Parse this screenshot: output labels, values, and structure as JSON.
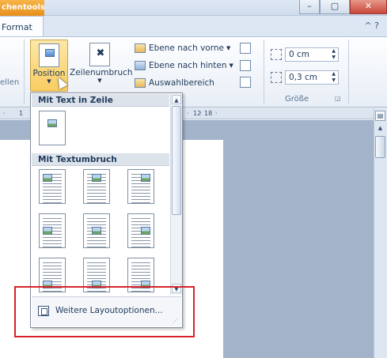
{
  "titlebar": {
    "context_tab_label": "chentools",
    "minimize": "–",
    "restore": "▢",
    "close": "✕"
  },
  "tabs": {
    "active_tab": "Format",
    "help_icons": "^ ?"
  },
  "ribbon": {
    "left_group_partial_label": "ellen",
    "position_button": "Position",
    "wrap_button": "Zeilenumbruch",
    "bring_forward": "Ebene nach vorne",
    "send_backward": "Ebene nach hinten",
    "selection_pane": "Auswahlbereich",
    "size_group_label": "Größe",
    "height_value": "0 cm",
    "width_value": "0,3 cm"
  },
  "ruler": {
    "marks": [
      "·",
      "1",
      "·",
      "12",
      "·",
      "18",
      "·"
    ]
  },
  "gallery": {
    "section_inline": "Mit Text in Zeile",
    "section_wrap": "Mit Textumbruch",
    "more_options": "Weitere Layoutoptionen...",
    "grip": "⋰"
  },
  "colors": {
    "accent_orange": "#e8901b",
    "highlight_red": "#d9222a",
    "ribbon_blue": "#1e395b"
  }
}
